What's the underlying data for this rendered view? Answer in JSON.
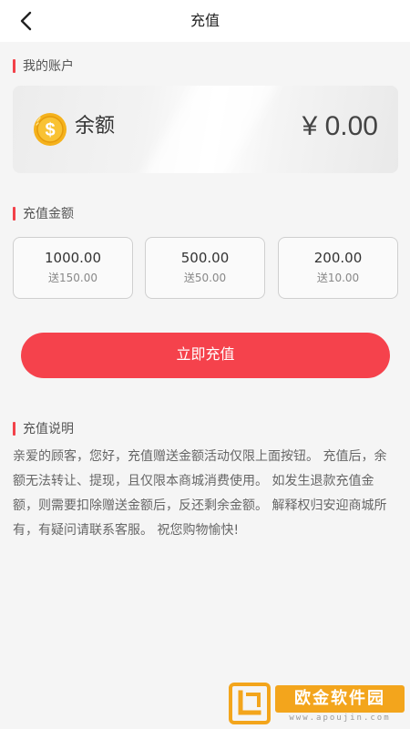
{
  "header": {
    "title": "充值",
    "back_icon": "chevron-left-icon"
  },
  "account": {
    "section_label": "我的账户",
    "balance_label": "余额",
    "balance_value": "¥ 0.00",
    "coin_icon": "dollar-coin-icon",
    "coin_symbol": "$"
  },
  "amounts": {
    "section_label": "充值金额",
    "options": [
      {
        "amount": "1000.00",
        "bonus": "送150.00"
      },
      {
        "amount": "500.00",
        "bonus": "送50.00"
      },
      {
        "amount": "200.00",
        "bonus": "送10.00"
      }
    ]
  },
  "recharge_button": {
    "label": "立即充值"
  },
  "description": {
    "section_label": "充值说明",
    "text": "亲爱的顾客，您好，充值赠送金额活动仅限上面按钮。 充值后，余额无法转让、提现，且仅限本商城消费使用。 如发生退款充值金额，则需要扣除赠送金额后，反还剩余金额。 解释权归安迎商城所有，有疑问请联系客服。 祝您购物愉快!"
  },
  "watermark": {
    "text": "欧金软件园",
    "url": "www.apoujin.com"
  },
  "colors": {
    "accent": "#f5424c",
    "coin": "#f5b21c",
    "watermark": "#f3a51c"
  }
}
